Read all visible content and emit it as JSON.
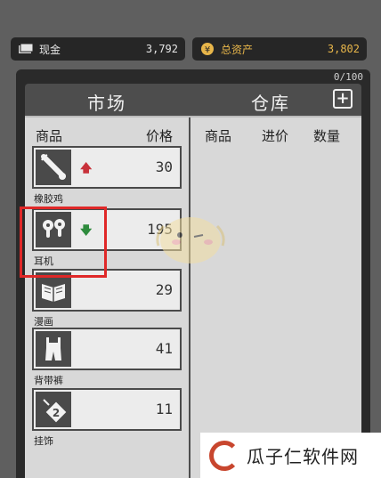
{
  "resources": {
    "cash": {
      "label": "现金",
      "value": "3,792",
      "icon": "cash-icon"
    },
    "total_assets": {
      "label": "总资产",
      "value": "3,802",
      "icon": "asset-icon"
    }
  },
  "panel": {
    "capacity": "0/100",
    "market_title": "市场",
    "warehouse_title": "仓库",
    "add_label": "+"
  },
  "market": {
    "col_product": "商品",
    "col_price": "价格",
    "items": [
      {
        "name": "橡胶鸡",
        "price": "30",
        "trend": "up",
        "trend_glyph": "🡅",
        "icon": "rubber-chicken-icon"
      },
      {
        "name": "耳机",
        "price": "195",
        "trend": "down",
        "trend_glyph": "🡇",
        "icon": "earbuds-icon"
      },
      {
        "name": "漫画",
        "price": "29",
        "trend": "none",
        "trend_glyph": "",
        "icon": "comic-book-icon"
      },
      {
        "name": "背带裤",
        "price": "41",
        "trend": "none",
        "trend_glyph": "",
        "icon": "overalls-icon"
      },
      {
        "name": "挂饰",
        "price": "11",
        "trend": "none",
        "trend_glyph": "",
        "icon": "pendant-icon"
      }
    ]
  },
  "warehouse": {
    "col_product": "商品",
    "col_cost": "进价",
    "col_qty": "数量"
  },
  "watermark": {
    "text": "瓜子仁软件网"
  },
  "colors": {
    "accent_gold": "#e8b64a",
    "trend_up": "#c8313a",
    "trend_down": "#2e8b3d",
    "highlight": "#e02828"
  }
}
